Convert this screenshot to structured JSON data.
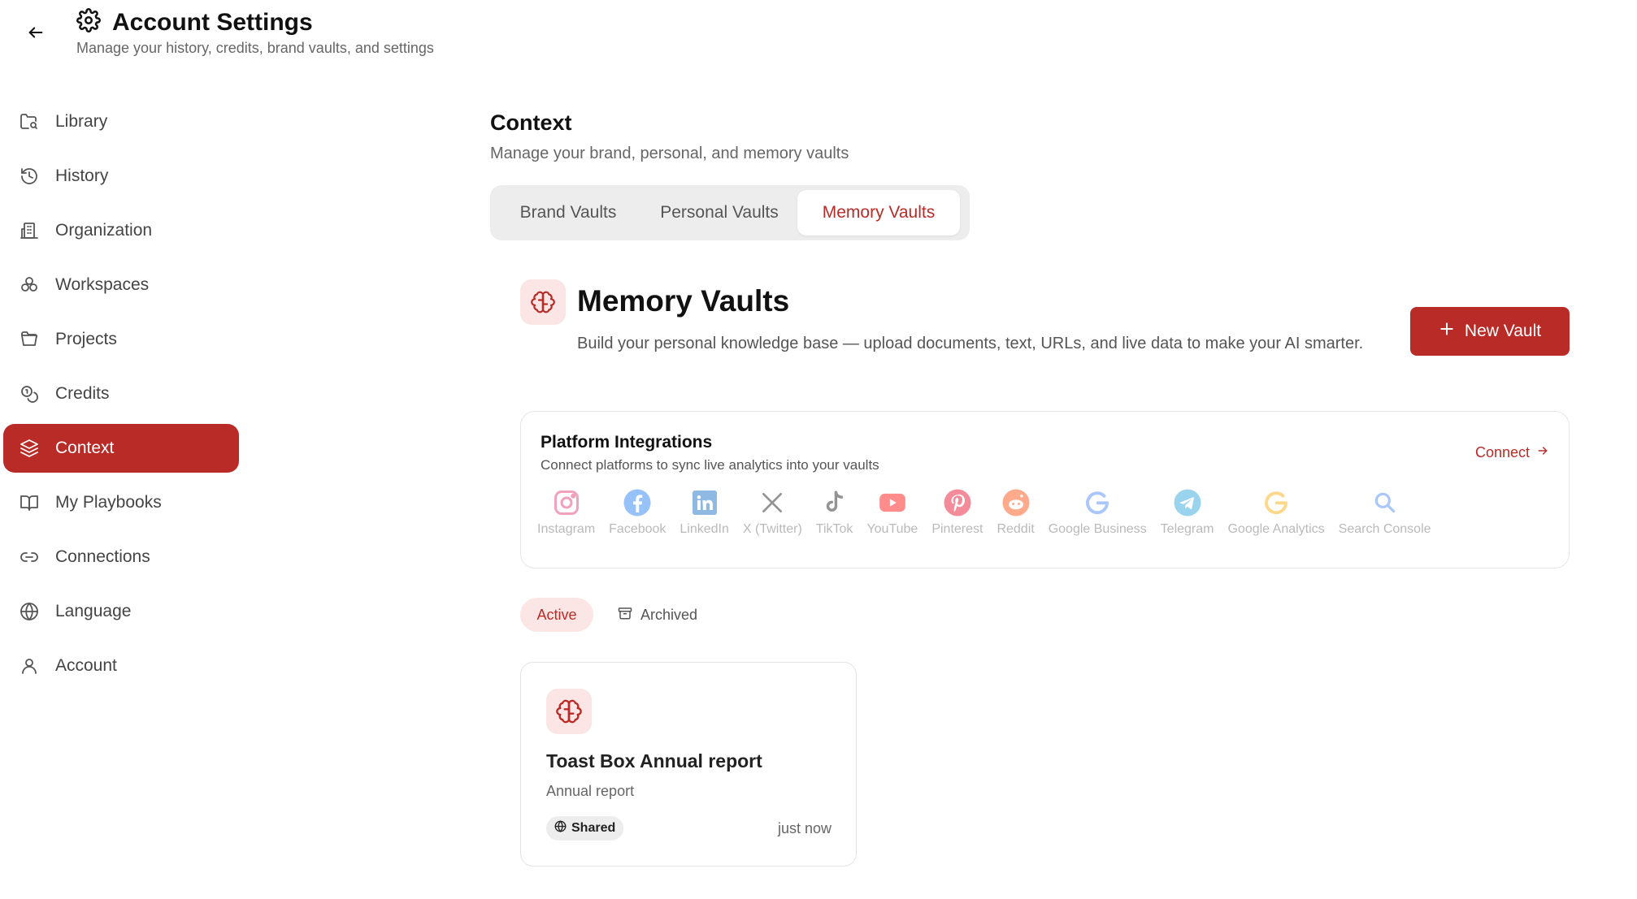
{
  "header": {
    "title": "Account Settings",
    "subtitle": "Manage your history, credits, brand vaults, and settings"
  },
  "sidebar": {
    "items": [
      {
        "label": "Library",
        "icon": "folder-search-icon"
      },
      {
        "label": "History",
        "icon": "history-icon"
      },
      {
        "label": "Organization",
        "icon": "building-icon"
      },
      {
        "label": "Workspaces",
        "icon": "workspaces-icon"
      },
      {
        "label": "Projects",
        "icon": "folder-icon"
      },
      {
        "label": "Credits",
        "icon": "coins-icon"
      },
      {
        "label": "Context",
        "icon": "layers-icon",
        "active": true
      },
      {
        "label": "My Playbooks",
        "icon": "book-icon"
      },
      {
        "label": "Connections",
        "icon": "link-icon"
      },
      {
        "label": "Language",
        "icon": "globe-icon"
      },
      {
        "label": "Account",
        "icon": "user-icon"
      }
    ]
  },
  "context": {
    "title": "Context",
    "subtitle": "Manage your brand, personal, and memory vaults",
    "tabs": [
      {
        "label": "Brand Vaults"
      },
      {
        "label": "Personal Vaults"
      },
      {
        "label": "Memory Vaults",
        "active": true
      }
    ]
  },
  "memory": {
    "title": "Memory Vaults",
    "description": "Build your personal knowledge base — upload documents, text, URLs, and live data to make your AI smarter.",
    "new_vault_label": "New Vault"
  },
  "integrations": {
    "title": "Platform Integrations",
    "subtitle": "Connect platforms to sync live analytics into your vaults",
    "connect_label": "Connect",
    "platforms": [
      {
        "label": "Instagram",
        "icon": "instagram-icon",
        "color": "#e1306c"
      },
      {
        "label": "Facebook",
        "icon": "facebook-icon",
        "color": "#1877f2"
      },
      {
        "label": "LinkedIn",
        "icon": "linkedin-icon",
        "color": "#0a66c2"
      },
      {
        "label": "X (Twitter)",
        "icon": "x-icon",
        "color": "#111111"
      },
      {
        "label": "TikTok",
        "icon": "tiktok-icon",
        "color": "#111111"
      },
      {
        "label": "YouTube",
        "icon": "youtube-icon",
        "color": "#ff0000"
      },
      {
        "label": "Pinterest",
        "icon": "pinterest-icon",
        "color": "#e60023"
      },
      {
        "label": "Reddit",
        "icon": "reddit-icon",
        "color": "#ff4500"
      },
      {
        "label": "Google Business",
        "icon": "google-icon",
        "color": "#4285f4"
      },
      {
        "label": "Telegram",
        "icon": "telegram-icon",
        "color": "#229ed9"
      },
      {
        "label": "Google Analytics",
        "icon": "google-analytics-icon",
        "color": "#f9ab00"
      },
      {
        "label": "Search Console",
        "icon": "search-icon",
        "color": "#4285f4"
      }
    ]
  },
  "filters": {
    "active_label": "Active",
    "archived_label": "Archived"
  },
  "vault_card": {
    "title": "Toast Box Annual report",
    "subtitle": "Annual report",
    "badge": "Shared",
    "time": "just now"
  },
  "colors": {
    "accent": "#b92b27",
    "accent_soft": "#fbe6e5"
  }
}
